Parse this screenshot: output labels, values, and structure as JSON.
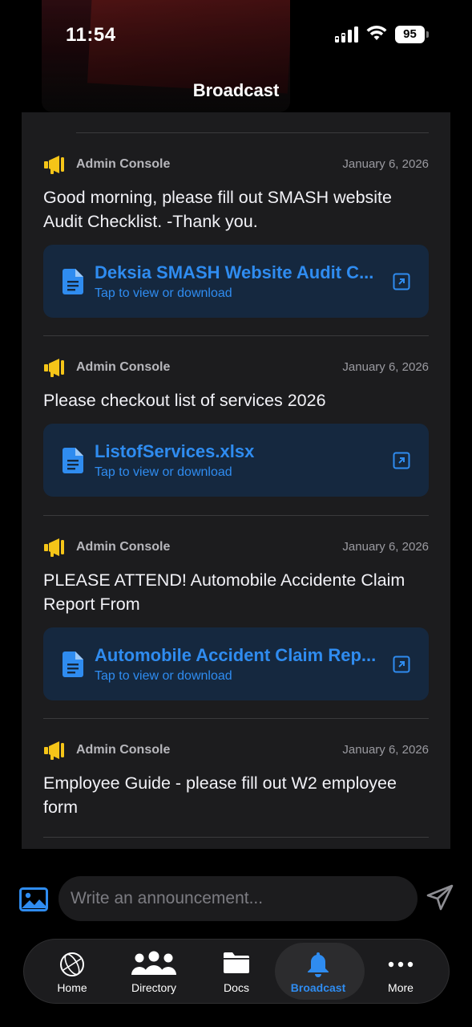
{
  "status_bar": {
    "time": "11:54",
    "battery": "95"
  },
  "header": {
    "title": "Broadcast"
  },
  "posts": [
    {
      "author": "Admin Console",
      "date": "January 6, 2026",
      "text": "Good morning, please fill out SMASH website Audit Checklist. -Thank you.",
      "attachment": {
        "name": "Deksia SMASH Website Audit C...",
        "subtitle": "Tap to view or download"
      }
    },
    {
      "author": "Admin Console",
      "date": "January 6, 2026",
      "text": "Please checkout list of services 2026",
      "attachment": {
        "name": "ListofServices.xlsx",
        "subtitle": "Tap to view or download"
      }
    },
    {
      "author": "Admin Console",
      "date": "January 6, 2026",
      "text": "PLEASE ATTEND! Automobile Accidente Claim Report From",
      "attachment": {
        "name": "Automobile Accident Claim Rep...",
        "subtitle": "Tap to view or download"
      }
    },
    {
      "author": "Admin Console",
      "date": "January 6, 2026",
      "text": "Employee Guide - please fill out W2 employee form"
    }
  ],
  "composer": {
    "placeholder": "Write an announcement..."
  },
  "tabs": [
    {
      "label": "Home",
      "icon": "home-logo-icon"
    },
    {
      "label": "Directory",
      "icon": "people-icon"
    },
    {
      "label": "Docs",
      "icon": "folder-icon"
    },
    {
      "label": "Broadcast",
      "icon": "bell-icon",
      "active": true
    },
    {
      "label": "More",
      "icon": "more-dots-icon"
    }
  ],
  "colors": {
    "accent": "#2f8cf0",
    "megaphone": "#f5c518",
    "panel": "#1c1c1e",
    "attachment_bg": "#15283f"
  }
}
